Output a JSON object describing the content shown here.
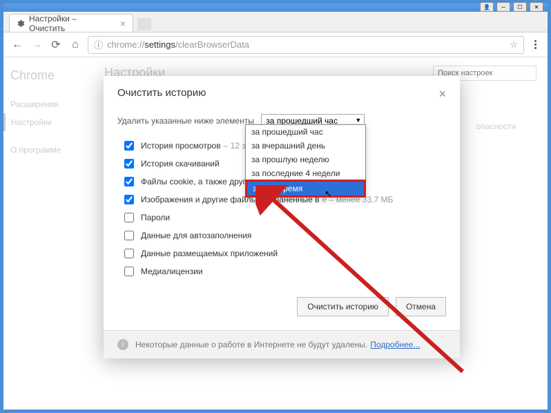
{
  "window": {
    "title": "Настройки – Очистить"
  },
  "address": {
    "scheme": "chrome://",
    "path_black": "settings",
    "path_rest": "/clearBrowserData"
  },
  "sidebar": {
    "brand": "Chrome",
    "items": [
      "Расширения",
      "Настройки",
      "О программе"
    ],
    "active_index": 1
  },
  "page": {
    "title": "Настройки",
    "search_placeholder": "Поиск настроек",
    "side_link": "опасности"
  },
  "dialog": {
    "title": "Очистить историю",
    "delete_label": "Удалить указанные ниже элементы",
    "selected_time": "за прошедший час",
    "time_options": [
      "за прошедший час",
      "за вчерашний день",
      "за прошлую неделю",
      "за последние 4 недели",
      "за все время"
    ],
    "highlighted_option_index": 4,
    "checks": [
      {
        "label": "История просмотров",
        "hint": "– 12 зап",
        "checked": true
      },
      {
        "label": "История скачиваний",
        "hint": "",
        "checked": true
      },
      {
        "label": "Файлы cookie, а также другие",
        "hint": "",
        "checked": true
      },
      {
        "label": "Изображения и другие файлы, сохраненные в",
        "hint": "е    – менее 33,7 МБ",
        "checked": true
      },
      {
        "label": "Пароли",
        "hint": "",
        "checked": false
      },
      {
        "label": "Данные для автозаполнения",
        "hint": "",
        "checked": false
      },
      {
        "label": "Данные размещаемых приложений",
        "hint": "",
        "checked": false
      },
      {
        "label": "Медиалицензии",
        "hint": "",
        "checked": false
      }
    ],
    "buttons": {
      "clear": "Очистить историю",
      "cancel": "Отмена"
    },
    "footer_text": "Некоторые данные о работе в Интернете не будут удалены.",
    "footer_link": "Подробнее..."
  }
}
